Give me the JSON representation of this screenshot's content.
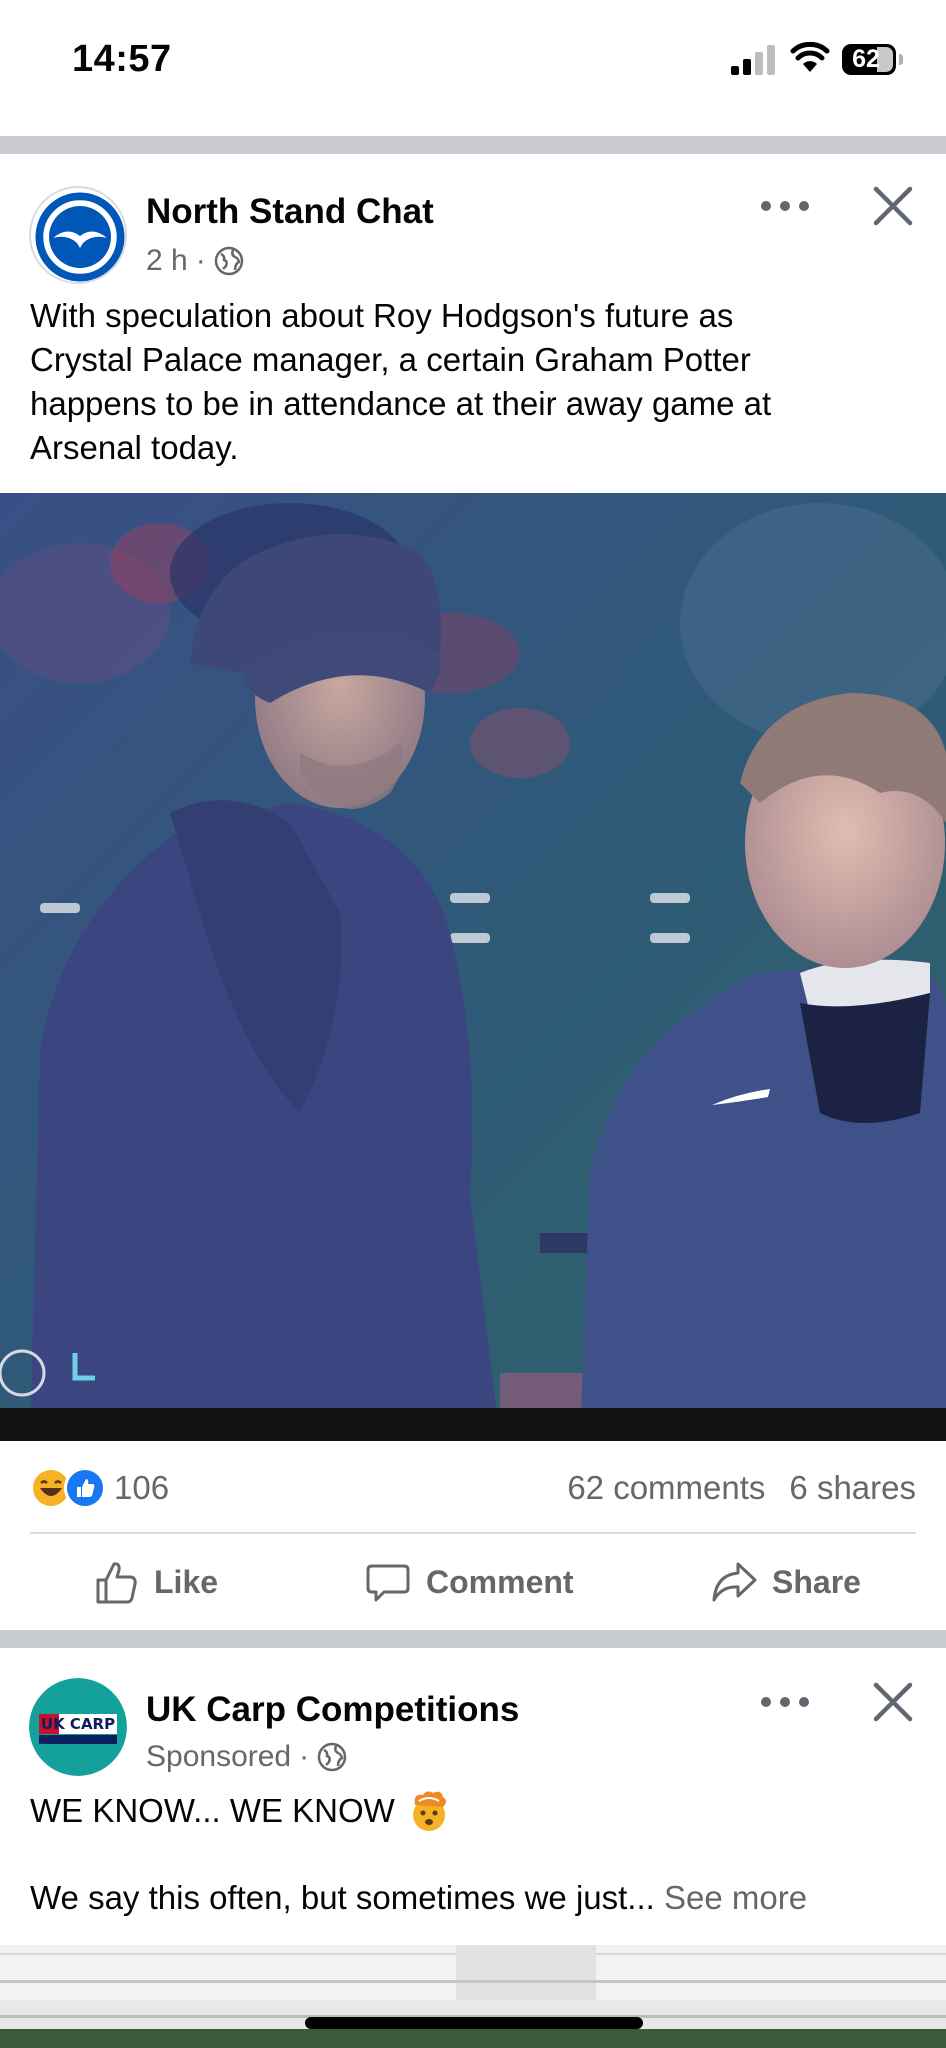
{
  "status_bar": {
    "time": "14:57",
    "battery": "62"
  },
  "post1": {
    "page_name": "North Stand Chat",
    "time": "2 h",
    "separator": "·",
    "avatar_icon": "brighton-seagull-crest",
    "text_lines": [
      "With speculation about Roy Hodgson's future as",
      "Crystal Palace manager, a certain Graham Potter",
      "happens to be in attendance at their away game at",
      "Arsenal today."
    ],
    "reactions": {
      "icons": [
        "laugh-emoji",
        "like-emoji"
      ],
      "count": "106"
    },
    "comments": "62 comments",
    "shares": "6 shares",
    "actions": {
      "like": "Like",
      "comment": "Comment",
      "share": "Share"
    }
  },
  "post2": {
    "page_name": "UK Carp Competitions",
    "sponsored": "Sponsored",
    "separator": "·",
    "avatar_icon": "uk-carp-competitions-logo",
    "headline": "WE KNOW... WE KNOW",
    "headline_emoji": "mind-blown-emoji",
    "body": "We say this often, but sometimes we just...",
    "see_more": "See more"
  },
  "colors": {
    "accent_blue": "#1877f2",
    "secondary_text": "#65676b",
    "divider": "#c9ccd1",
    "crest_blue": "#0057b8",
    "carp_teal": "#15a19b"
  }
}
